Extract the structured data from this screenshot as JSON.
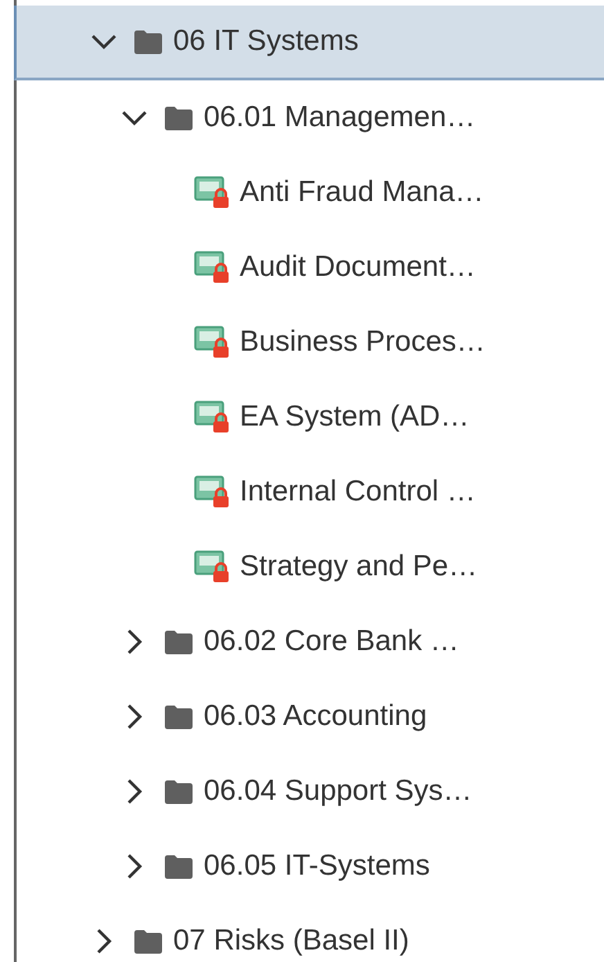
{
  "tree": [
    {
      "label": "06 IT Systems",
      "kind": "folder",
      "expanded": true,
      "selected": true,
      "children": [
        {
          "label": "06.01 Managemen…",
          "kind": "folder",
          "expanded": true,
          "selected": false,
          "children": [
            {
              "label": "Anti Fraud Mana…",
              "kind": "locked-app",
              "selected": false
            },
            {
              "label": "Audit Document…",
              "kind": "locked-app",
              "selected": false
            },
            {
              "label": "Business Proces…",
              "kind": "locked-app",
              "selected": false
            },
            {
              "label": "EA System (AD…",
              "kind": "locked-app",
              "selected": false
            },
            {
              "label": "Internal Control …",
              "kind": "locked-app",
              "selected": false
            },
            {
              "label": "Strategy and Pe…",
              "kind": "locked-app",
              "selected": false
            }
          ]
        },
        {
          "label": "06.02 Core Bank …",
          "kind": "folder",
          "expanded": false,
          "selected": false
        },
        {
          "label": "06.03 Accounting",
          "kind": "folder",
          "expanded": false,
          "selected": false
        },
        {
          "label": "06.04 Support Sys…",
          "kind": "folder",
          "expanded": false,
          "selected": false
        },
        {
          "label": "06.05 IT-Systems",
          "kind": "folder",
          "expanded": false,
          "selected": false
        }
      ]
    },
    {
      "label": "07 Risks (Basel II)",
      "kind": "folder",
      "expanded": false,
      "selected": false
    }
  ]
}
